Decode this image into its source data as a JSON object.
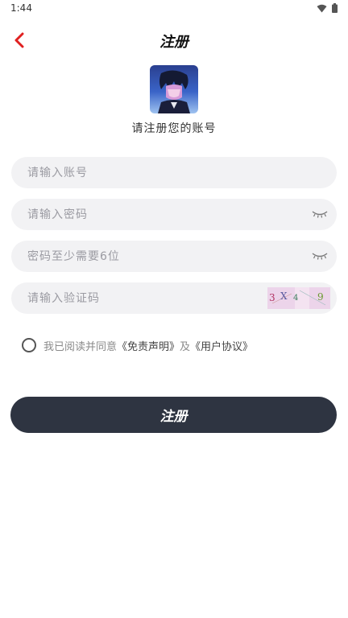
{
  "status_bar": {
    "time": "1:44",
    "wifi_icon": "wifi-icon",
    "battery_icon": "battery-icon"
  },
  "header": {
    "title": "注册",
    "back_icon": "chevron-left-icon"
  },
  "subtitle": "请注册您的账号",
  "fields": {
    "account": {
      "placeholder": "请输入账号",
      "value": ""
    },
    "password": {
      "placeholder": "请输入密码",
      "value": "",
      "toggle_icon": "eye-closed-icon"
    },
    "confirm": {
      "placeholder": "密码至少需要6位",
      "value": "",
      "toggle_icon": "eye-closed-icon"
    },
    "code": {
      "placeholder": "请输入验证码",
      "value": ""
    }
  },
  "captcha": {
    "chars": [
      "3",
      "X",
      "4",
      "9"
    ]
  },
  "agreement": {
    "prefix": "我已阅读并同意",
    "disclaimer": "《免责声明》",
    "and": "及",
    "user_agreement": "《用户协议》",
    "checked": false
  },
  "submit_label": "注册",
  "colors": {
    "accent": "#e02020",
    "button": "#2e3441",
    "field_bg": "#f2f2f4",
    "captcha_bg": "#ecd4ea"
  }
}
